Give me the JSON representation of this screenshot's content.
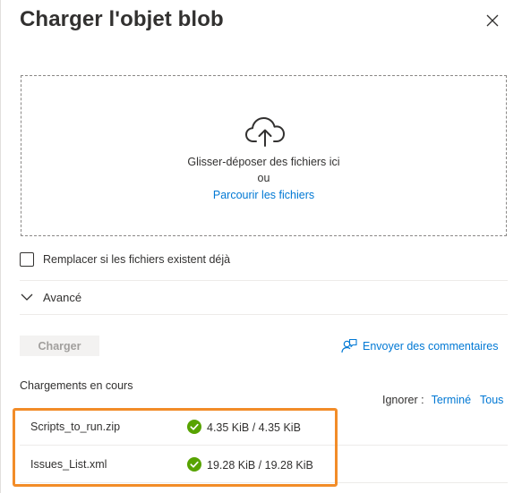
{
  "dialog": {
    "title": "Charger l'objet blob",
    "close_icon": "close-icon"
  },
  "dropzone": {
    "icon": "cloud-upload-icon",
    "instruction": "Glisser-déposer des fichiers ici",
    "or": "ou",
    "browse_label": "Parcourir les fichiers"
  },
  "overwrite": {
    "label": "Remplacer si les fichiers existent déjà",
    "checked": false
  },
  "advanced": {
    "label": "Avancé",
    "icon": "chevron-down-icon"
  },
  "actions": {
    "upload_label": "Charger",
    "upload_enabled": false,
    "feedback_label": "Envoyer des commentaires",
    "feedback_icon": "feedback-icon"
  },
  "uploads": {
    "heading": "Chargements en cours",
    "dismiss_label": "Ignorer :",
    "dismiss_completed": "Terminé",
    "dismiss_all": "Tous",
    "items": [
      {
        "name": "Scripts_to_run.zip",
        "progress": "4.35 KiB / 4.35 KiB",
        "status": "completed",
        "status_icon": "check-circle-icon"
      },
      {
        "name": "Issues_List.xml",
        "progress": "19.28 KiB / 19.28 KiB",
        "status": "completed",
        "status_icon": "check-circle-icon"
      }
    ]
  },
  "colors": {
    "accent": "#0078d4",
    "success": "#57a300",
    "highlight": "#f28c28",
    "text": "#323130"
  }
}
